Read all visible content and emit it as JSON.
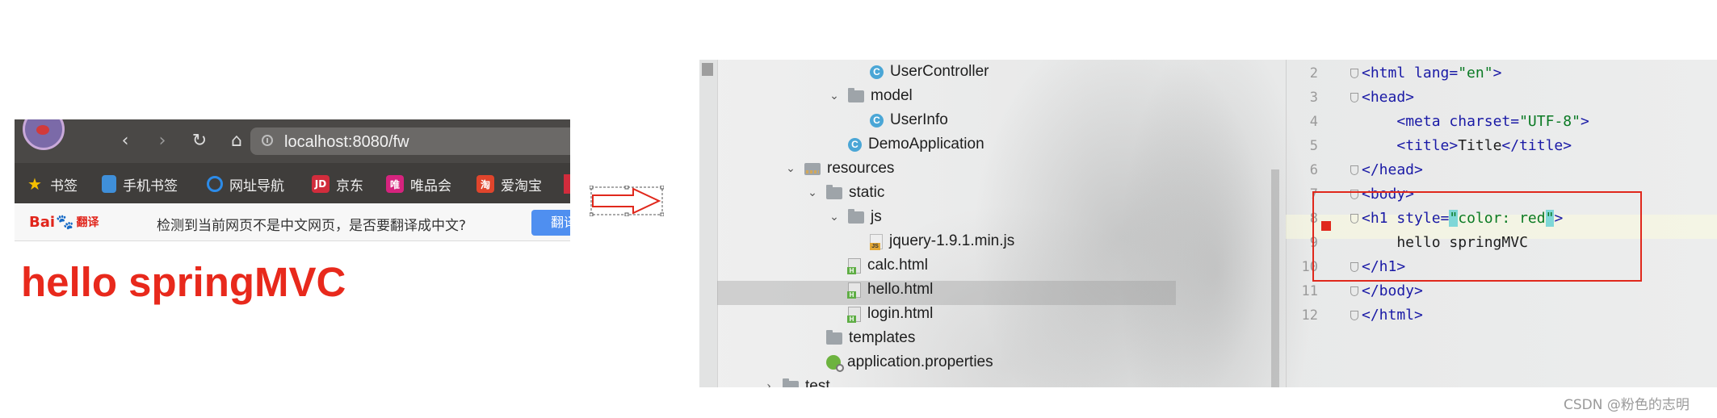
{
  "browser": {
    "url": "localhost:8080/fw",
    "nav": {
      "back": "‹",
      "forward": "›",
      "reload": "↻",
      "home": "⌂"
    },
    "bookmarks": [
      {
        "label": "书签",
        "icon": "star-icon",
        "glyph": "★"
      },
      {
        "label": "手机书签",
        "icon": "phone-icon",
        "glyph": ""
      },
      {
        "label": "网址导航",
        "icon": "edge-icon",
        "glyph": ""
      },
      {
        "label": "京东",
        "icon": "jd-icon",
        "glyph": "JD"
      },
      {
        "label": "唯品会",
        "icon": "vip-icon",
        "glyph": "唯"
      },
      {
        "label": "爱淘宝",
        "icon": "taobao-icon",
        "glyph": "淘"
      }
    ],
    "translate": {
      "logo_bai": "Bai",
      "logo_paw": "🐾",
      "logo_du": "翻译",
      "message": "检测到当前网页不是中文网页，是否要翻译成中文?",
      "button": "翻译"
    },
    "content_heading": "hello springMVC",
    "heading_color": "#e8291c"
  },
  "project_tree": [
    {
      "label": "UserController",
      "type": "class",
      "expanded": null
    },
    {
      "label": "model",
      "type": "folder",
      "expanded": true
    },
    {
      "label": "UserInfo",
      "type": "class",
      "expanded": null
    },
    {
      "label": "DemoApplication",
      "type": "spring-class",
      "expanded": null
    },
    {
      "label": "resources",
      "type": "resources-folder",
      "expanded": true
    },
    {
      "label": "static",
      "type": "folder",
      "expanded": true
    },
    {
      "label": "js",
      "type": "folder",
      "expanded": true
    },
    {
      "label": "jquery-1.9.1.min.js",
      "type": "js",
      "expanded": null
    },
    {
      "label": "calc.html",
      "type": "html",
      "expanded": null
    },
    {
      "label": "hello.html",
      "type": "html",
      "expanded": null,
      "selected": true
    },
    {
      "label": "login.html",
      "type": "html",
      "expanded": null
    },
    {
      "label": "templates",
      "type": "folder",
      "expanded": null
    },
    {
      "label": "application.properties",
      "type": "properties",
      "expanded": null
    },
    {
      "label": "test",
      "type": "folder",
      "expanded": false
    }
  ],
  "editor": {
    "lines": [
      {
        "num": "2",
        "parts": [
          [
            "tag",
            "<html "
          ],
          [
            "attr",
            "lang="
          ],
          [
            "val",
            "\"en\""
          ],
          [
            "tag",
            ">"
          ]
        ]
      },
      {
        "num": "3",
        "parts": [
          [
            "tag",
            "<head>"
          ]
        ]
      },
      {
        "num": "4",
        "parts": [
          [
            "plain",
            "    "
          ],
          [
            "tag",
            "<meta "
          ],
          [
            "attr",
            "charset="
          ],
          [
            "val",
            "\"UTF-8\""
          ],
          [
            "tag",
            ">"
          ]
        ]
      },
      {
        "num": "5",
        "parts": [
          [
            "plain",
            "    "
          ],
          [
            "tag",
            "<title>"
          ],
          [
            "plain",
            "Title"
          ],
          [
            "tag",
            "</title>"
          ]
        ]
      },
      {
        "num": "6",
        "parts": [
          [
            "tag",
            "</head>"
          ]
        ]
      },
      {
        "num": "7",
        "parts": [
          [
            "tag",
            "<body>"
          ]
        ]
      },
      {
        "num": "8",
        "parts": [
          [
            "tag",
            "<h1 "
          ],
          [
            "attr",
            "style="
          ],
          [
            "hlval",
            "\""
          ],
          [
            "val",
            "color: red"
          ],
          [
            "hlval",
            "\""
          ],
          [
            "tag",
            ">"
          ]
        ]
      },
      {
        "num": "9",
        "parts": [
          [
            "plain",
            "    hello springMVC"
          ]
        ]
      },
      {
        "num": "10",
        "parts": [
          [
            "tag",
            "</h1>"
          ]
        ]
      },
      {
        "num": "11",
        "parts": [
          [
            "tag",
            "</body>"
          ]
        ]
      },
      {
        "num": "12",
        "parts": [
          [
            "tag",
            "</html>"
          ]
        ]
      }
    ],
    "highlight_color": "#e0281c"
  },
  "watermark": "CSDN @粉色的志明"
}
